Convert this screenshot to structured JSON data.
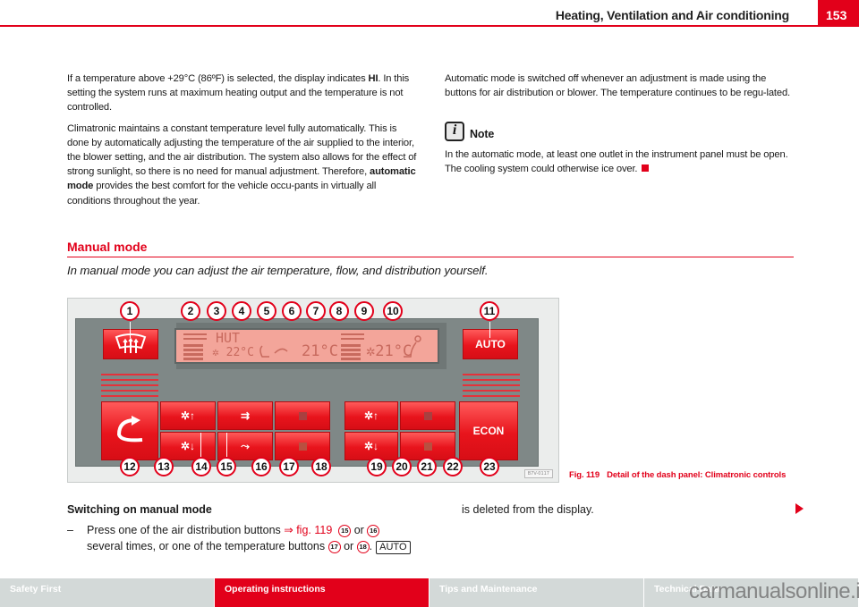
{
  "header": {
    "title": "Heating, Ventilation and Air conditioning",
    "page_number": "153",
    "accent_color": "#e2001a"
  },
  "left_column": {
    "para1_a": "If a temperature above +29°C  (86ºF) is selected, the display indicates ",
    "para1_bold": "HI",
    "para1_b": ". In this setting the system runs at maximum heating output and the temperature is not controlled.",
    "para2_a": "Climatronic maintains a constant temperature level fully automatically. This is done by automatically adjusting the temperature of the air supplied to the interior, the blower setting, and the air distribution. The system also allows for the effect of strong sunlight, so there is no need for manual adjustment. Therefore, ",
    "para2_bold": "automatic mode",
    "para2_b": " provides the best comfort for the vehicle occu-pants in virtually all conditions throughout the year."
  },
  "right_column": {
    "para1": "Automatic mode is switched off whenever an adjustment is made using the buttons for air distribution or blower. The temperature continues to be regu-lated.",
    "note": {
      "icon": "info-icon",
      "icon_glyph": "i",
      "title": "Note",
      "text": "In the automatic mode, at least one outlet in the instrument panel must be open. The cooling system could otherwise ice over."
    }
  },
  "section": {
    "title": "Manual mode",
    "subtitle": "In manual mode you can adjust the air temperature, flow, and distribution yourself."
  },
  "figure": {
    "auto_label": "AUTO",
    "econ_label": "ECON",
    "display": {
      "left_mode": "HUT",
      "left_temp": "22°C",
      "center_temp": "21°C",
      "right_temp": "21°C"
    },
    "callouts_top": [
      "1",
      "2",
      "3",
      "4",
      "5",
      "6",
      "7",
      "8",
      "9",
      "10",
      "11"
    ],
    "callouts_bottom": [
      "12",
      "13",
      "14",
      "15",
      "16",
      "17",
      "18",
      "19",
      "20",
      "21",
      "22",
      "23"
    ],
    "image_id": "B7V-0117",
    "caption_number": "Fig. 119",
    "caption_text": "Detail of the dash panel: Climatronic controls"
  },
  "instructions": {
    "heading": "Switching on manual mode",
    "dash": "–",
    "step_a": "Press one of the air distribution buttons ",
    "step_xref": "⇒ fig. 119",
    "ref1": "15",
    "or1": " or ",
    "ref2": "16",
    "step_b": "several times, or one of the temperature buttons ",
    "ref3": "17",
    "or2": " or ",
    "ref4": "18",
    "period": ".",
    "key_label": "AUTO",
    "continuation": "is deleted from the display."
  },
  "footer": {
    "tabs": [
      {
        "label": "Safety First",
        "active": false
      },
      {
        "label": "Operating instructions",
        "active": true
      },
      {
        "label": "Tips and Maintenance",
        "active": false
      },
      {
        "label": "Technical Data",
        "active": false
      }
    ],
    "watermark": "carmanualsonline.info"
  }
}
